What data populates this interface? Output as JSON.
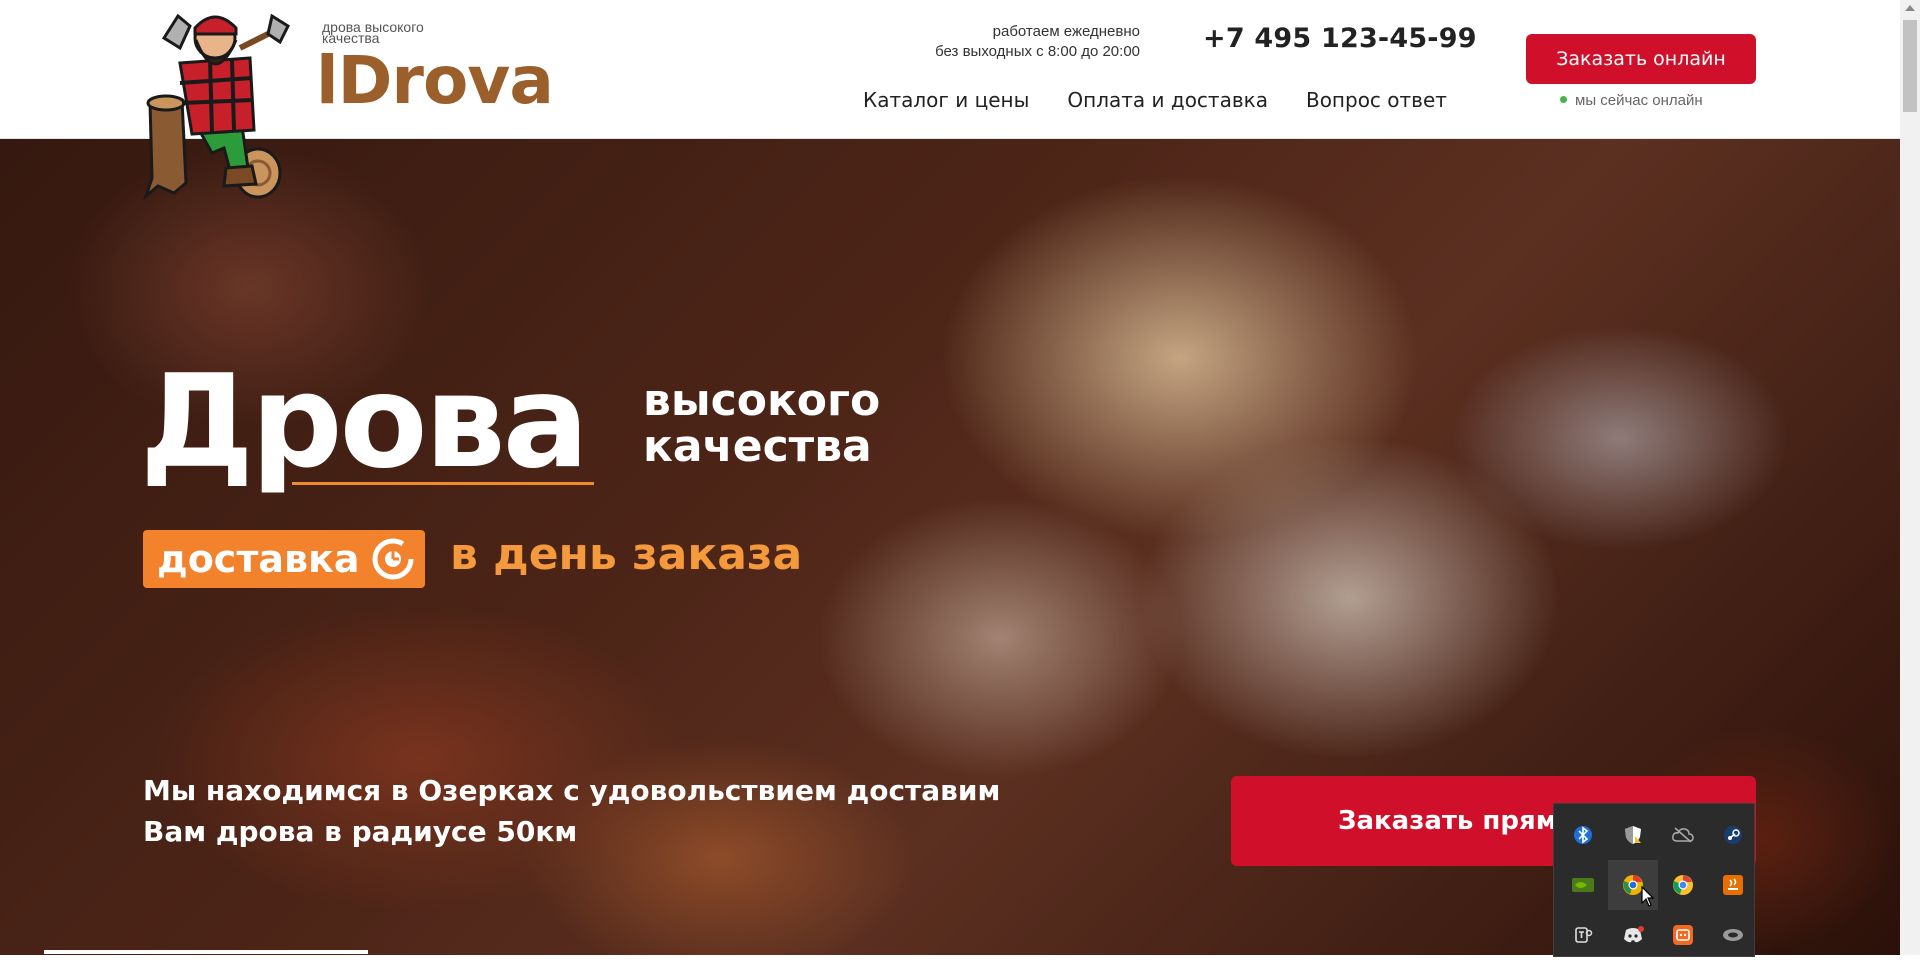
{
  "header": {
    "brand_tagline": "дрова высокого качества",
    "brand_name": "lDrova",
    "hours_line1": "работаем ежедневно",
    "hours_line2": "без выходных с 8:00 до 20:00",
    "phone": "+7 495 123-45-99",
    "nav": [
      "Каталог и цены",
      "Оплата и доставка",
      "Вопрос ответ"
    ],
    "order_button": "Заказать онлайн",
    "online_status": "мы сейчас онлайн"
  },
  "hero": {
    "title": "Дрова",
    "subtitle_line1": "высокого",
    "subtitle_line2": "качества",
    "badge_text": "доставка",
    "delivery_text": "в день заказа",
    "location_line1": "Мы находимся в Озерках с удовольствием доставим",
    "location_line2": "Вам дрова в радиусе 50км",
    "order_button": "Заказать прямо"
  },
  "tray": {
    "icons": [
      "bluetooth-icon",
      "security-shield-icon",
      "cloud-offline-icon",
      "steam-icon",
      "nvidia-icon",
      "chrome-canary-icon",
      "chrome-icon",
      "java-icon",
      "teams-icon",
      "discord-icon",
      "app-orange-icon",
      "vpn-icon"
    ]
  },
  "colors": {
    "accent_red": "#d0102a",
    "accent_orange": "#f2822c",
    "brand_brown": "#9a5f2a"
  }
}
